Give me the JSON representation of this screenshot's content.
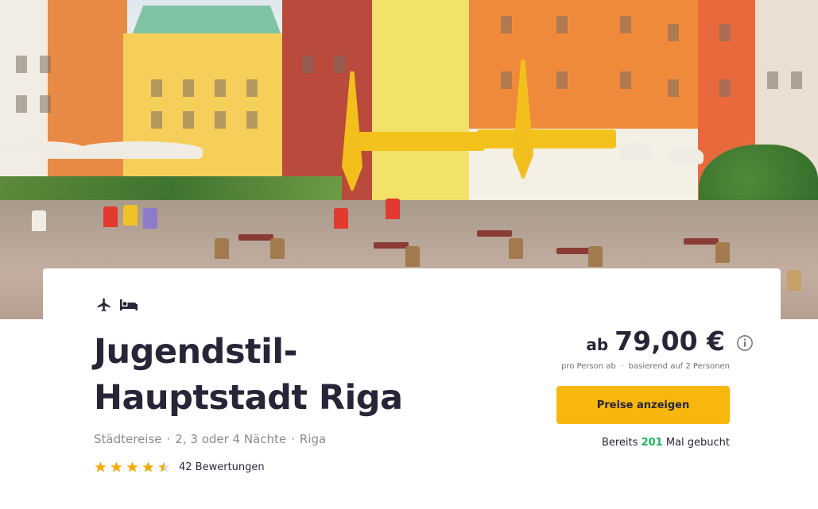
{
  "hero": {
    "alt": "Riga old town square with café terraces"
  },
  "card": {
    "icons": [
      "plane-icon",
      "bed-icon"
    ],
    "title": "Jugendstil-Hauptstadt Riga",
    "meta": {
      "trip_type": "Städtereise",
      "duration": "2, 3 oder 4 Nächte",
      "city": "Riga"
    },
    "rating": {
      "stars": 4.5,
      "max": 5,
      "reviews_label": "42 Bewertungen"
    },
    "price": {
      "prefix": "ab",
      "value": "79,00 €",
      "per_person": "pro Person ab",
      "basis": "basierend auf 2 Personen"
    },
    "cta_label": "Preise anzeigen",
    "booked": {
      "before": "Bereits",
      "count": "201",
      "after": "Mal gebucht"
    }
  },
  "colors": {
    "accent": "#f8b70d",
    "star": "#f5a900",
    "booked_count": "#1fb35a",
    "text_dark": "#262638",
    "text_muted": "#8a8a93"
  }
}
